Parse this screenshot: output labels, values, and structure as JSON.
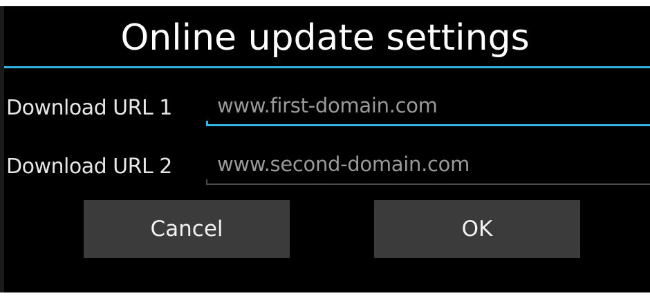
{
  "dialog": {
    "title": "Online update settings",
    "accent_color": "#33b5e5",
    "fields": [
      {
        "label": "Download URL 1",
        "value": "",
        "placeholder": "www.first-domain.com",
        "focused": true
      },
      {
        "label": "Download URL 2",
        "value": "",
        "placeholder": "www.second-domain.com",
        "focused": false
      }
    ],
    "buttons": {
      "cancel_label": "Cancel",
      "ok_label": "OK"
    }
  }
}
